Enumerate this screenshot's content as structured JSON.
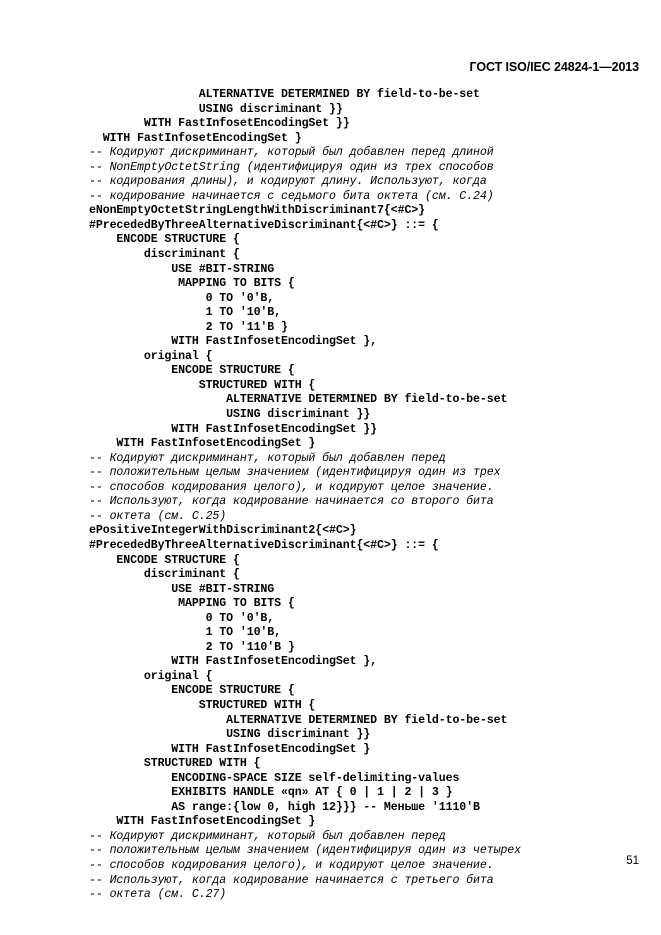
{
  "document": {
    "running_head": "ГОСТ ISO/IEC 24824-1—2013",
    "page_number": "51"
  },
  "code_listing": {
    "lines": [
      {
        "kind": "code",
        "text": "                ALTERNATIVE DETERMINED BY field-to-be-set"
      },
      {
        "kind": "code",
        "text": "                USING discriminant }}"
      },
      {
        "kind": "code",
        "text": "        WITH FastInfosetEncodingSet }}"
      },
      {
        "kind": "code",
        "text": "  WITH FastInfosetEncodingSet }"
      },
      {
        "kind": "comment",
        "text": "-- Кодируют дискриминант, который был добавлен перед длиной"
      },
      {
        "kind": "comment",
        "text": "-- NonEmptyOctetString (идентифицируя один из трех способов"
      },
      {
        "kind": "comment",
        "text": "-- кодирования длины), и кодируют длину. Используют, когда"
      },
      {
        "kind": "comment",
        "text": "-- кодирование начинается с седьмого бита октета (см. С.24)"
      },
      {
        "kind": "code",
        "text": "eNonEmptyOctetStringLengthWithDiscriminant7{<#C>}"
      },
      {
        "kind": "code",
        "text": "#PrecededByThreeAlternativeDiscriminant{<#C>} ::= {"
      },
      {
        "kind": "code",
        "text": "    ENCODE STRUCTURE {"
      },
      {
        "kind": "code",
        "text": "        discriminant {"
      },
      {
        "kind": "code",
        "text": "            USE #BIT-STRING"
      },
      {
        "kind": "code",
        "text": "             MAPPING TO BITS {"
      },
      {
        "kind": "code",
        "text": "                 0 TO '0'B,"
      },
      {
        "kind": "code",
        "text": "                 1 TO '10'B,"
      },
      {
        "kind": "code",
        "text": "                 2 TO '11'B }"
      },
      {
        "kind": "code",
        "text": "            WITH FastInfosetEncodingSet },"
      },
      {
        "kind": "code",
        "text": "        original {"
      },
      {
        "kind": "code",
        "text": "            ENCODE STRUCTURE {"
      },
      {
        "kind": "code",
        "text": "                STRUCTURED WITH {"
      },
      {
        "kind": "code",
        "text": "                    ALTERNATIVE DETERMINED BY field-to-be-set"
      },
      {
        "kind": "code",
        "text": "                    USING discriminant }}"
      },
      {
        "kind": "code",
        "text": "            WITH FastInfosetEncodingSet }}"
      },
      {
        "kind": "code",
        "text": "    WITH FastInfosetEncodingSet }"
      },
      {
        "kind": "comment",
        "text": "-- Кодируют дискриминант, который был добавлен перед"
      },
      {
        "kind": "comment",
        "text": "-- положительным целым значением (идентифицируя один из трех"
      },
      {
        "kind": "comment",
        "text": "-- способов кодирования целого), и кодируют целое значение."
      },
      {
        "kind": "comment",
        "text": "-- Используют, когда кодирование начинается со второго бита"
      },
      {
        "kind": "comment",
        "text": "-- октета (см. С.25)"
      },
      {
        "kind": "code",
        "text": "ePositiveIntegerWithDiscriminant2{<#C>}"
      },
      {
        "kind": "code",
        "text": "#PrecededByThreeAlternativeDiscriminant{<#C>} ::= {"
      },
      {
        "kind": "code",
        "text": "    ENCODE STRUCTURE {"
      },
      {
        "kind": "code",
        "text": "        discriminant {"
      },
      {
        "kind": "code",
        "text": "            USE #BIT-STRING"
      },
      {
        "kind": "code",
        "text": "             MAPPING TO BITS {"
      },
      {
        "kind": "code",
        "text": "                 0 TO '0'B,"
      },
      {
        "kind": "code",
        "text": "                 1 TO '10'B,"
      },
      {
        "kind": "code",
        "text": "                 2 TO '110'B }"
      },
      {
        "kind": "code",
        "text": "            WITH FastInfosetEncodingSet },"
      },
      {
        "kind": "code",
        "text": "        original {"
      },
      {
        "kind": "code",
        "text": "            ENCODE STRUCTURE {"
      },
      {
        "kind": "code",
        "text": "                STRUCTURED WITH {"
      },
      {
        "kind": "code",
        "text": "                    ALTERNATIVE DETERMINED BY field-to-be-set"
      },
      {
        "kind": "code",
        "text": "                    USING discriminant }}"
      },
      {
        "kind": "code",
        "text": "            WITH FastInfosetEncodingSet }"
      },
      {
        "kind": "code",
        "text": "        STRUCTURED WITH {"
      },
      {
        "kind": "code",
        "text": "            ENCODING-SPACE SIZE self-delimiting-values"
      },
      {
        "kind": "code",
        "text": "            EXHIBITS HANDLE «qn» AT { 0 | 1 | 2 | 3 }"
      },
      {
        "kind": "code",
        "text": "            AS range:{low 0, high 12}}} -- Меньше '1110'B"
      },
      {
        "kind": "code",
        "text": "    WITH FastInfosetEncodingSet }"
      },
      {
        "kind": "comment",
        "text": "-- Кодируют дискриминант, который был добавлен перед"
      },
      {
        "kind": "comment",
        "text": "-- положительным целым значением (идентифицируя один из четырех"
      },
      {
        "kind": "comment",
        "text": "-- способов кодирования целого), и кодируют целое значение."
      },
      {
        "kind": "comment",
        "text": "-- Используют, когда кодирование начинается с третьего бита"
      },
      {
        "kind": "comment",
        "text": "-- октета (см. С.27)"
      }
    ]
  }
}
